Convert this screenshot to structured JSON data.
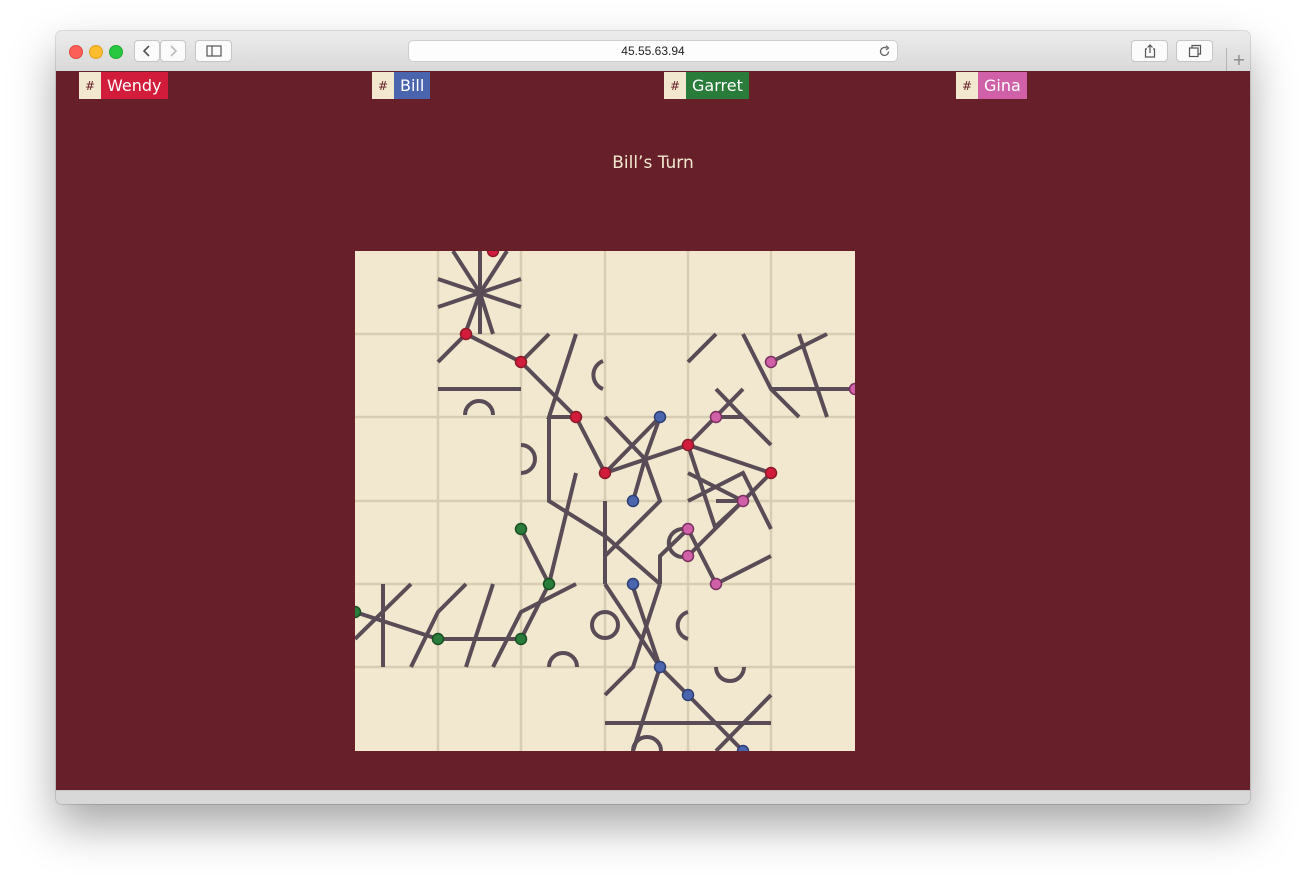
{
  "browser": {
    "url": "45.55.63.94"
  },
  "players": [
    {
      "name": "Wendy",
      "hash": "#",
      "color": "#d21c3c"
    },
    {
      "name": "Bill",
      "hash": "#",
      "color": "#4a64ad"
    },
    {
      "name": "Garret",
      "hash": "#",
      "color": "#2a7c3a"
    },
    {
      "name": "Gina",
      "hash": "#",
      "color": "#d061a8"
    }
  ],
  "status": {
    "turn_text": "Bill’s Turn"
  },
  "colors": {
    "background": "#67202a",
    "board": "#f1e8cf",
    "track": "#5a4c56",
    "wendy": "#d21c3c",
    "bill": "#4a64ad",
    "garret": "#2a7c3a",
    "gina": "#d061a8"
  },
  "board": {
    "grid_size": 6
  }
}
